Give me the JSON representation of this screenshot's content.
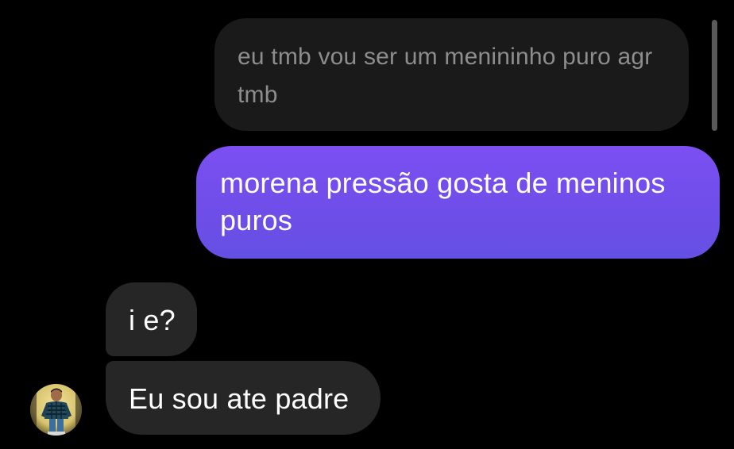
{
  "conversation": {
    "quoted_message": {
      "text": "eu tmb vou ser um menininho puro agr tmb"
    },
    "sent_message": {
      "text": "morena pressão gosta de meninos puros",
      "color": "#7150ec"
    },
    "received_messages": [
      {
        "text": "i e?"
      },
      {
        "text": "Eu sou ate padre"
      }
    ],
    "sender_avatar": {
      "icon": "profile-photo-boy"
    }
  }
}
